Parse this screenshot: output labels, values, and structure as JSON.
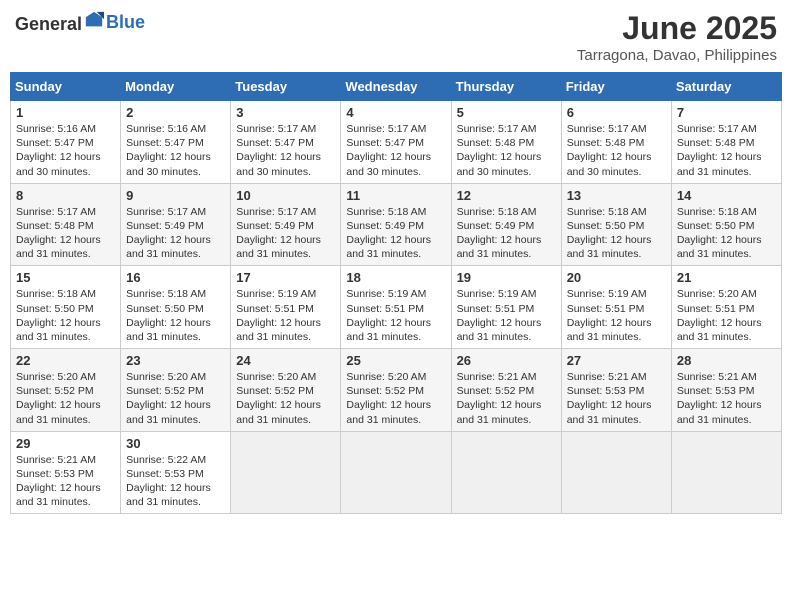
{
  "header": {
    "logo_general": "General",
    "logo_blue": "Blue",
    "month": "June 2025",
    "location": "Tarragona, Davao, Philippines"
  },
  "weekdays": [
    "Sunday",
    "Monday",
    "Tuesday",
    "Wednesday",
    "Thursday",
    "Friday",
    "Saturday"
  ],
  "weeks": [
    [
      {
        "day": "1",
        "sunrise": "5:16 AM",
        "sunset": "5:47 PM",
        "daylight": "12 hours and 30 minutes."
      },
      {
        "day": "2",
        "sunrise": "5:16 AM",
        "sunset": "5:47 PM",
        "daylight": "12 hours and 30 minutes."
      },
      {
        "day": "3",
        "sunrise": "5:17 AM",
        "sunset": "5:47 PM",
        "daylight": "12 hours and 30 minutes."
      },
      {
        "day": "4",
        "sunrise": "5:17 AM",
        "sunset": "5:47 PM",
        "daylight": "12 hours and 30 minutes."
      },
      {
        "day": "5",
        "sunrise": "5:17 AM",
        "sunset": "5:48 PM",
        "daylight": "12 hours and 30 minutes."
      },
      {
        "day": "6",
        "sunrise": "5:17 AM",
        "sunset": "5:48 PM",
        "daylight": "12 hours and 30 minutes."
      },
      {
        "day": "7",
        "sunrise": "5:17 AM",
        "sunset": "5:48 PM",
        "daylight": "12 hours and 31 minutes."
      }
    ],
    [
      {
        "day": "8",
        "sunrise": "5:17 AM",
        "sunset": "5:48 PM",
        "daylight": "12 hours and 31 minutes."
      },
      {
        "day": "9",
        "sunrise": "5:17 AM",
        "sunset": "5:49 PM",
        "daylight": "12 hours and 31 minutes."
      },
      {
        "day": "10",
        "sunrise": "5:17 AM",
        "sunset": "5:49 PM",
        "daylight": "12 hours and 31 minutes."
      },
      {
        "day": "11",
        "sunrise": "5:18 AM",
        "sunset": "5:49 PM",
        "daylight": "12 hours and 31 minutes."
      },
      {
        "day": "12",
        "sunrise": "5:18 AM",
        "sunset": "5:49 PM",
        "daylight": "12 hours and 31 minutes."
      },
      {
        "day": "13",
        "sunrise": "5:18 AM",
        "sunset": "5:50 PM",
        "daylight": "12 hours and 31 minutes."
      },
      {
        "day": "14",
        "sunrise": "5:18 AM",
        "sunset": "5:50 PM",
        "daylight": "12 hours and 31 minutes."
      }
    ],
    [
      {
        "day": "15",
        "sunrise": "5:18 AM",
        "sunset": "5:50 PM",
        "daylight": "12 hours and 31 minutes."
      },
      {
        "day": "16",
        "sunrise": "5:18 AM",
        "sunset": "5:50 PM",
        "daylight": "12 hours and 31 minutes."
      },
      {
        "day": "17",
        "sunrise": "5:19 AM",
        "sunset": "5:51 PM",
        "daylight": "12 hours and 31 minutes."
      },
      {
        "day": "18",
        "sunrise": "5:19 AM",
        "sunset": "5:51 PM",
        "daylight": "12 hours and 31 minutes."
      },
      {
        "day": "19",
        "sunrise": "5:19 AM",
        "sunset": "5:51 PM",
        "daylight": "12 hours and 31 minutes."
      },
      {
        "day": "20",
        "sunrise": "5:19 AM",
        "sunset": "5:51 PM",
        "daylight": "12 hours and 31 minutes."
      },
      {
        "day": "21",
        "sunrise": "5:20 AM",
        "sunset": "5:51 PM",
        "daylight": "12 hours and 31 minutes."
      }
    ],
    [
      {
        "day": "22",
        "sunrise": "5:20 AM",
        "sunset": "5:52 PM",
        "daylight": "12 hours and 31 minutes."
      },
      {
        "day": "23",
        "sunrise": "5:20 AM",
        "sunset": "5:52 PM",
        "daylight": "12 hours and 31 minutes."
      },
      {
        "day": "24",
        "sunrise": "5:20 AM",
        "sunset": "5:52 PM",
        "daylight": "12 hours and 31 minutes."
      },
      {
        "day": "25",
        "sunrise": "5:20 AM",
        "sunset": "5:52 PM",
        "daylight": "12 hours and 31 minutes."
      },
      {
        "day": "26",
        "sunrise": "5:21 AM",
        "sunset": "5:52 PM",
        "daylight": "12 hours and 31 minutes."
      },
      {
        "day": "27",
        "sunrise": "5:21 AM",
        "sunset": "5:53 PM",
        "daylight": "12 hours and 31 minutes."
      },
      {
        "day": "28",
        "sunrise": "5:21 AM",
        "sunset": "5:53 PM",
        "daylight": "12 hours and 31 minutes."
      }
    ],
    [
      {
        "day": "29",
        "sunrise": "5:21 AM",
        "sunset": "5:53 PM",
        "daylight": "12 hours and 31 minutes."
      },
      {
        "day": "30",
        "sunrise": "5:22 AM",
        "sunset": "5:53 PM",
        "daylight": "12 hours and 31 minutes."
      },
      null,
      null,
      null,
      null,
      null
    ]
  ]
}
